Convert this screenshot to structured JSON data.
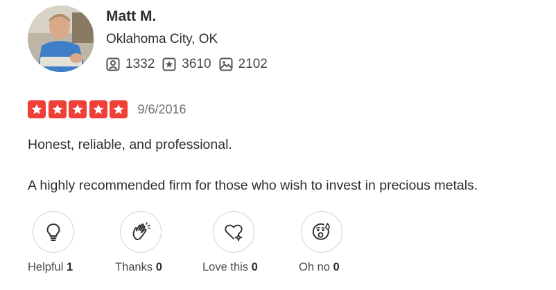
{
  "user": {
    "name": "Matt M.",
    "location": "Oklahoma City, OK",
    "stats": {
      "friends": "1332",
      "reviews": "3610",
      "photos": "2102"
    }
  },
  "review": {
    "rating": 5,
    "date": "9/6/2016",
    "lines": [
      "Honest, reliable, and professional.",
      "A highly recommended firm for those who wish to invest in precious metals."
    ]
  },
  "reactions": [
    {
      "label": "Helpful",
      "count": "1"
    },
    {
      "label": "Thanks",
      "count": "0"
    },
    {
      "label": "Love this",
      "count": "0"
    },
    {
      "label": "Oh no",
      "count": "0"
    }
  ],
  "colors": {
    "star_red": "#ef3f36",
    "text": "#2d2e2f",
    "muted": "#6e7072"
  }
}
